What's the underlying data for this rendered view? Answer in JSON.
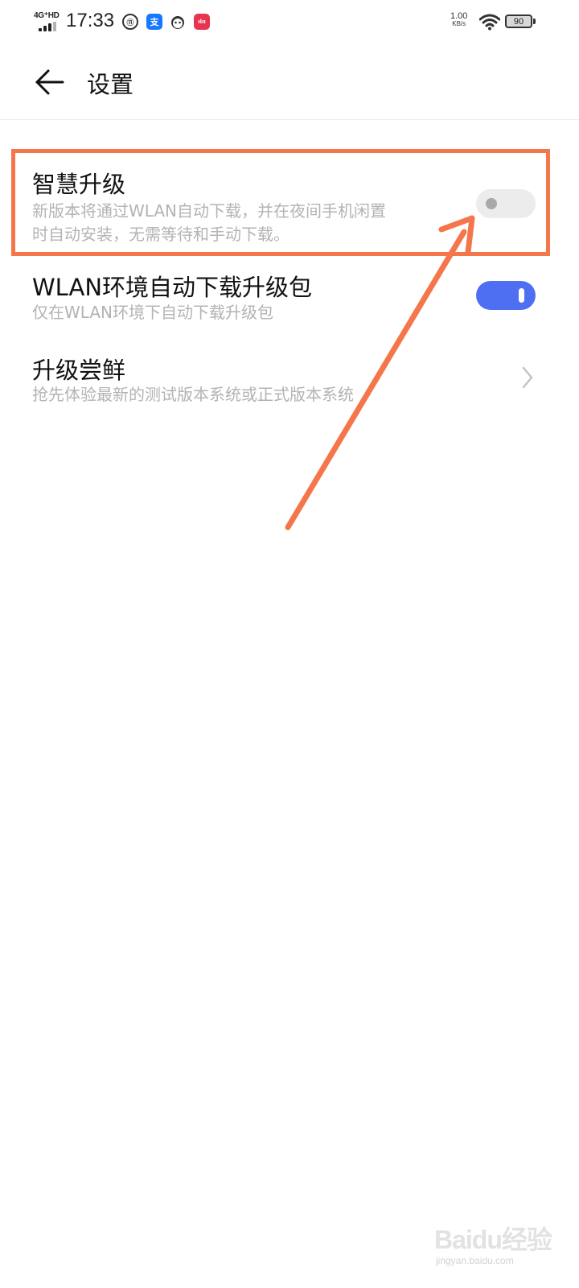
{
  "status_bar": {
    "network": "4G⁺HD",
    "time": "17:33",
    "unicom_icon": "unicom-icon",
    "alipay_glyph": "支",
    "speed_value": "1.00",
    "speed_unit": "KB/s",
    "battery": "90"
  },
  "header": {
    "title": "设置",
    "back_icon": "back-arrow-icon"
  },
  "settings": {
    "smart_upgrade": {
      "title": "智慧升级",
      "desc_line1": "新版本将通过WLAN自动下载，并在夜间手机闲置",
      "desc_line2": "时自动安装，无需等待和手动下载。",
      "enabled": false
    },
    "wlan_download": {
      "title": "WLAN环境自动下载升级包",
      "desc": "仅在WLAN环境下自动下载升级包",
      "enabled": true
    },
    "beta_upgrade": {
      "title": "升级尝鲜",
      "desc": "抢先体验最新的测试版本系统或正式版本系统"
    }
  },
  "annotation": {
    "color": "#f4764a"
  },
  "watermark": {
    "logo": "Baidu经验",
    "url": "jingyan.baidu.com"
  },
  "colors": {
    "accent": "#4f6ff2",
    "annotation": "#f4764a"
  }
}
